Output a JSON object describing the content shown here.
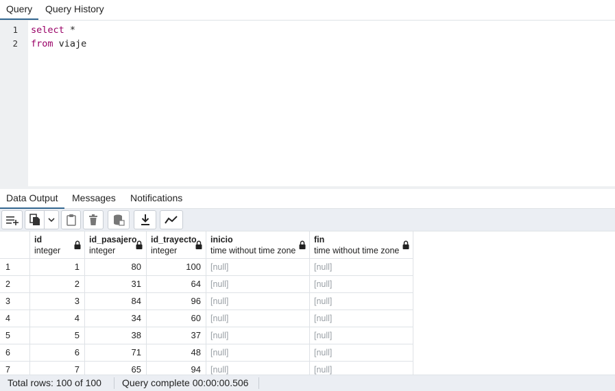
{
  "top_tabs": [
    "Query",
    "Query History"
  ],
  "editor": {
    "lines": [
      {
        "number": "1",
        "keyword": "select",
        "rest": " *"
      },
      {
        "number": "2",
        "keyword": "from",
        "rest": " viaje"
      }
    ]
  },
  "bottom_tabs": [
    "Data Output",
    "Messages",
    "Notifications"
  ],
  "toolbar": {
    "icons": [
      "add-row-icon",
      "copy-icon",
      "chevron-down-icon",
      "paste-icon",
      "delete-icon",
      "save-data-icon",
      "download-icon",
      "graph-visualiser-icon"
    ]
  },
  "table": {
    "columns": [
      {
        "name": "id",
        "type": "integer"
      },
      {
        "name": "id_pasajero",
        "type": "integer"
      },
      {
        "name": "id_trayecto",
        "type": "integer"
      },
      {
        "name": "inicio",
        "type": "time without time zone"
      },
      {
        "name": "fin",
        "type": "time without time zone"
      }
    ],
    "rows": [
      [
        "1",
        "1",
        "80",
        "100",
        "[null]",
        "[null]"
      ],
      [
        "2",
        "2",
        "31",
        "64",
        "[null]",
        "[null]"
      ],
      [
        "3",
        "3",
        "84",
        "96",
        "[null]",
        "[null]"
      ],
      [
        "4",
        "4",
        "34",
        "60",
        "[null]",
        "[null]"
      ],
      [
        "5",
        "5",
        "38",
        "37",
        "[null]",
        "[null]"
      ],
      [
        "6",
        "6",
        "71",
        "48",
        "[null]",
        "[null]"
      ],
      [
        "7",
        "7",
        "65",
        "94",
        "[null]",
        "[null]"
      ]
    ]
  },
  "status": {
    "total_rows": "Total rows: 100 of 100",
    "query_complete": "Query complete 00:00:00.506"
  },
  "colors": {
    "accent": "#326690",
    "keyword": "#990066",
    "null_text": "#9aa0a6",
    "toolbar_bg": "#ebeef3"
  }
}
